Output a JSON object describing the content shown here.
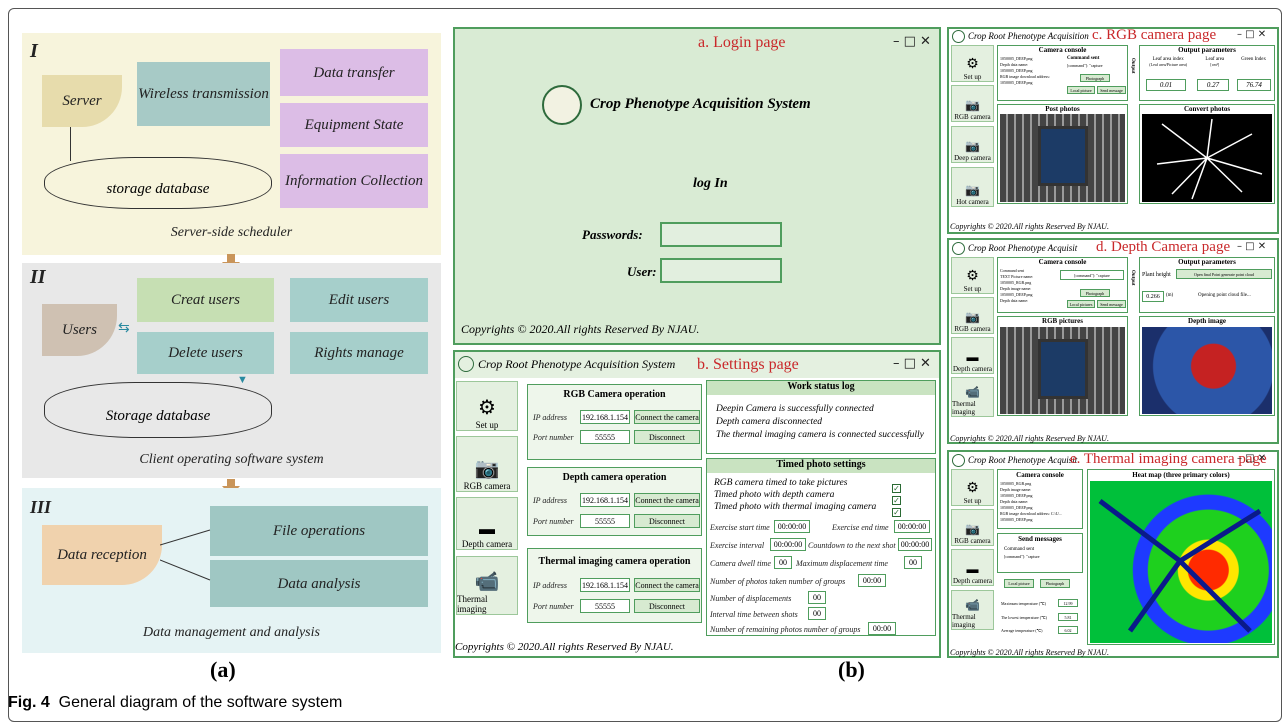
{
  "figure_caption": {
    "label": "Fig. 4",
    "text": "General diagram of the software system"
  },
  "panel_labels": {
    "a": "(a)",
    "b": "(b)"
  },
  "diagram": {
    "tier1": {
      "roman": "I",
      "server": "Server",
      "wireless": "Wireless transmission",
      "data_transfer": "Data transfer",
      "equipment_state": "Equipment State",
      "information_collection": "Information Collection",
      "database": "storage database",
      "caption": "Server-side scheduler"
    },
    "tier2": {
      "roman": "II",
      "users": "Users",
      "creat_users": "Creat users",
      "edit_users": "Edit users",
      "delete_users": "Delete users",
      "rights_manage": "Rights manage",
      "database": "Storage database",
      "caption": "Client operating software system"
    },
    "tier3": {
      "roman": "III",
      "data_reception": "Data reception",
      "file_operations": "File operations",
      "data_analysis": "Data analysis",
      "caption": "Data management and analysis"
    }
  },
  "login": {
    "heading": "a. Login page",
    "system_title": "Crop  Phenotype Acquisition System",
    "log_in": "log In",
    "passwords_label": "Passwords:",
    "user_label": "User:",
    "copyright": "Copyrights © 2020.All rights Reserved By NJAU.",
    "win_controls": "– □ ✕"
  },
  "settings": {
    "app_title": "Crop Root Phenotype Acquisition System",
    "heading": "b. Settings page",
    "sidebar": [
      "Set up",
      "RGB camera",
      "Depth camera",
      "Thermal imaging"
    ],
    "rgb_op": {
      "title": "RGB Camera operation",
      "ip_label": "IP address",
      "ip": "192.168.1.154",
      "port_label": "Port number",
      "port": "55555",
      "connect": "Connect the camera",
      "disconnect": "Disconnect"
    },
    "depth_op": {
      "title": "Depth camera operation",
      "ip_label": "IP address",
      "ip": "192.168.1.154",
      "port_label": "Port number",
      "port": "55555",
      "connect": "Connect the camera",
      "disconnect": "Disconnect"
    },
    "thermal_op": {
      "title": "Thermal imaging camera operation",
      "ip_label": "IP address",
      "ip": "192.168.1.154",
      "port_label": "Port number",
      "port": "55555",
      "connect": "Connect the camera",
      "disconnect": "Disconnect"
    },
    "work_log": {
      "title": "Work status log",
      "lines": [
        "Deepin Camera is successfully connected",
        "Depth camera disconnected",
        "The thermal imaging camera is connected successfully"
      ]
    },
    "timed": {
      "title": "Timed photo settings",
      "checks": [
        "RGB camera timed to take pictures",
        "Timed photo with depth camera",
        "Timed photo with thermal imaging camera"
      ],
      "start_label": "Exercise start time",
      "start": "00:00:00",
      "end_label": "Exercise end time",
      "end": "00:00:00",
      "interval_label": "Exercise interval",
      "interval": "00:00:00",
      "countdown_label": "Countdown to the next shot",
      "countdown": "00:00:00",
      "dwell_label": "Camera dwell time",
      "dwell": "00",
      "maxdisp_label": "Maximum displacement time",
      "maxdisp": "00",
      "groups_label": "Number of photos taken number of groups",
      "groups": "00:00",
      "disp_label": "Number of displacements",
      "disp": "00",
      "shots_label": "Interval time between shots",
      "shots": "00",
      "remaining_label": "Number of remaining photos number of groups",
      "remaining": "00:00"
    },
    "copyright": "Copyrights © 2020.All rights Reserved By NJAU."
  },
  "rgb_page": {
    "app_title": "Crop Root Phenotype Acquisition",
    "heading": "c. RGB camera page",
    "sidebar": [
      "Set up",
      "RGB camera",
      "Deep camera",
      "Hot camera"
    ],
    "console_title": "Camera console",
    "console_lines": [
      "1050005_DEEP.png",
      "Depth data name:",
      "1050005_DEEP.png",
      "RGB image download address:",
      "1050005_DEEP.png"
    ],
    "command_label": "Command sent",
    "command_value": "[command\"]:  \"capture",
    "photograph": "Photograph",
    "local_picture": "Local picture",
    "send_message": "Send message",
    "output_label": "Output",
    "output_title": "Output parameters",
    "out_heads": [
      "Leaf area index",
      "Leaf area",
      "Green Index"
    ],
    "out_sub": [
      "(Leaf area/Picture area)",
      "[cm²]",
      ""
    ],
    "out_values": [
      "0.01",
      "0.27",
      "76.74"
    ],
    "post_photos": "Post photos",
    "convert_photos": "Convert photos",
    "copyright": "Copyrights © 2020.All rights Reserved By NJAU."
  },
  "depth_page": {
    "app_title": "Crop Root Phenotype Acquisit",
    "heading": "d. Depth Camera page",
    "sidebar": [
      "Set up",
      "RGB camera",
      "Depth camera",
      "Thermal imaging"
    ],
    "console_title": "Camera console",
    "console_lines": [
      "Command sent",
      "TEXT Picture name:",
      "1050005_RGB.png",
      "Depth image name:",
      "1050005_DEEP.png",
      "Depth data name:"
    ],
    "command_value": "[command\"]:  \"capture",
    "photograph": "Photograph",
    "local_pictures": "Local pictures",
    "send_message": "Send message",
    "output_label": "Output",
    "output_title": "Output parameters",
    "plant_height_label": "Plant height",
    "plant_height": "0.266",
    "unit": "(m)",
    "open_btn": "Open final Point generate point cloud",
    "opening": "Opening point cloud file...",
    "rgb_pictures": "RGB pictures",
    "depth_image": "Depth image",
    "copyright": "Copyrights © 2020.All rights Reserved By NJAU."
  },
  "thermal_page": {
    "app_title": "Crop Root Phenotype Acquisit",
    "heading": "e. Thermal imaging camera page",
    "sidebar": [
      "Set up",
      "RGB camera",
      "Depth camera",
      "Thermal imaging"
    ],
    "console_title": "Camera console",
    "console_lines": [
      "1050005_RGB.png",
      "Depth image name:",
      "1050005_DEEP.png",
      "Depth data name:",
      "1050005_DEEP.png",
      "RGB image download address: C:\\U...",
      "1050005_DEEP.png"
    ],
    "send_messages": "Send messages",
    "command_label": "Command sent",
    "command_value": "[command\"]:  \"capture",
    "local_picture": "Local picture",
    "photograph": "Photograph",
    "heat_map": "Heat map (three primary colors)",
    "max_label": "Maximum temperature (℃)",
    "max": "12.99",
    "min_label": "The lowest temperature (℃)",
    "min": "5.81",
    "avg_label": "Average temperature (℃)",
    "avg": "6.02",
    "copyright": "Copyrights © 2020.All rights Reserved By NJAU."
  }
}
